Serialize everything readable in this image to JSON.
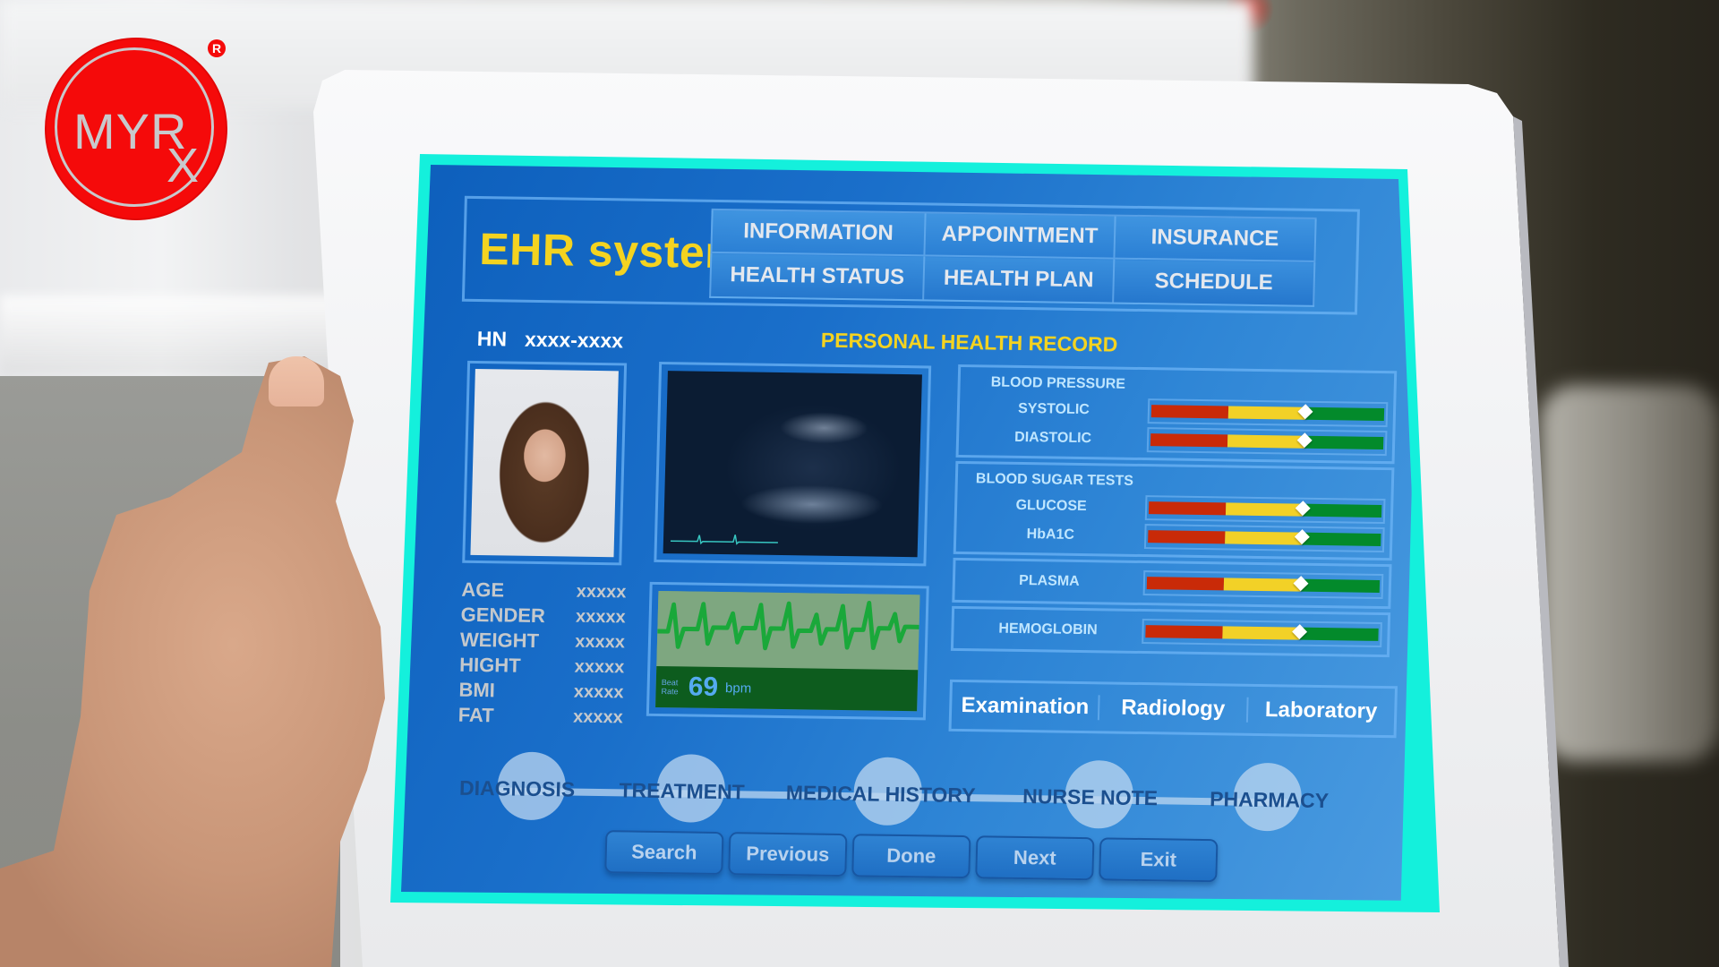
{
  "brand": {
    "logo_text": "MYR",
    "logo_subscript": "X",
    "registered_mark": "R",
    "colors": {
      "logo_red": "#f50a0a",
      "screen_border": "#14f0dc"
    }
  },
  "app": {
    "title": "EHR system",
    "nav": [
      "INFORMATION",
      "APPOINTMENT",
      "INSURANCE",
      "HEALTH STATUS",
      "HEALTH PLAN",
      "SCHEDULE"
    ]
  },
  "patient": {
    "hn_label": "HN",
    "hn_value": "xxxx-xxxx",
    "section_title": "PERSONAL HEALTH RECORD",
    "vitals": [
      {
        "label": "AGE",
        "value": "xxxxx"
      },
      {
        "label": "GENDER",
        "value": "xxxxx"
      },
      {
        "label": "WEIGHT",
        "value": "xxxxx"
      },
      {
        "label": "HIGHT",
        "value": "xxxxx"
      },
      {
        "label": "BMI",
        "value": "xxxxx"
      },
      {
        "label": "FAT",
        "value": "xxxxx"
      }
    ]
  },
  "heart_rate": {
    "label_line1": "Beat",
    "label_line2": "Rate",
    "value": "69",
    "unit": "bpm"
  },
  "metrics": {
    "blood_pressure": {
      "title": "BLOOD PRESSURE",
      "rows": [
        {
          "label": "SYSTOLIC",
          "level": 0.66
        },
        {
          "label": "DIASTOLIC",
          "level": 0.66
        }
      ]
    },
    "blood_sugar": {
      "title": "BLOOD SUGAR TESTS",
      "rows": [
        {
          "label": "GLUCOSE",
          "level": 0.66
        },
        {
          "label": "HbA1C",
          "level": 0.66
        }
      ]
    },
    "plasma": {
      "label": "PLASMA",
      "level": 0.66
    },
    "hemoglobin": {
      "label": "HEMOGLOBIN",
      "level": 0.66
    },
    "scale_colors": {
      "low": "#c92a08",
      "mid": "#f2d127",
      "high": "#038a2b"
    }
  },
  "tabs": [
    "Examination",
    "Radiology",
    "Laboratory"
  ],
  "timeline": [
    "DIAGNOSIS",
    "TREATMENT",
    "MEDICAL HISTORY",
    "NURSE NOTE",
    "PHARMACY"
  ],
  "buttons": [
    "Search",
    "Previous",
    "Done",
    "Next",
    "Exit"
  ]
}
